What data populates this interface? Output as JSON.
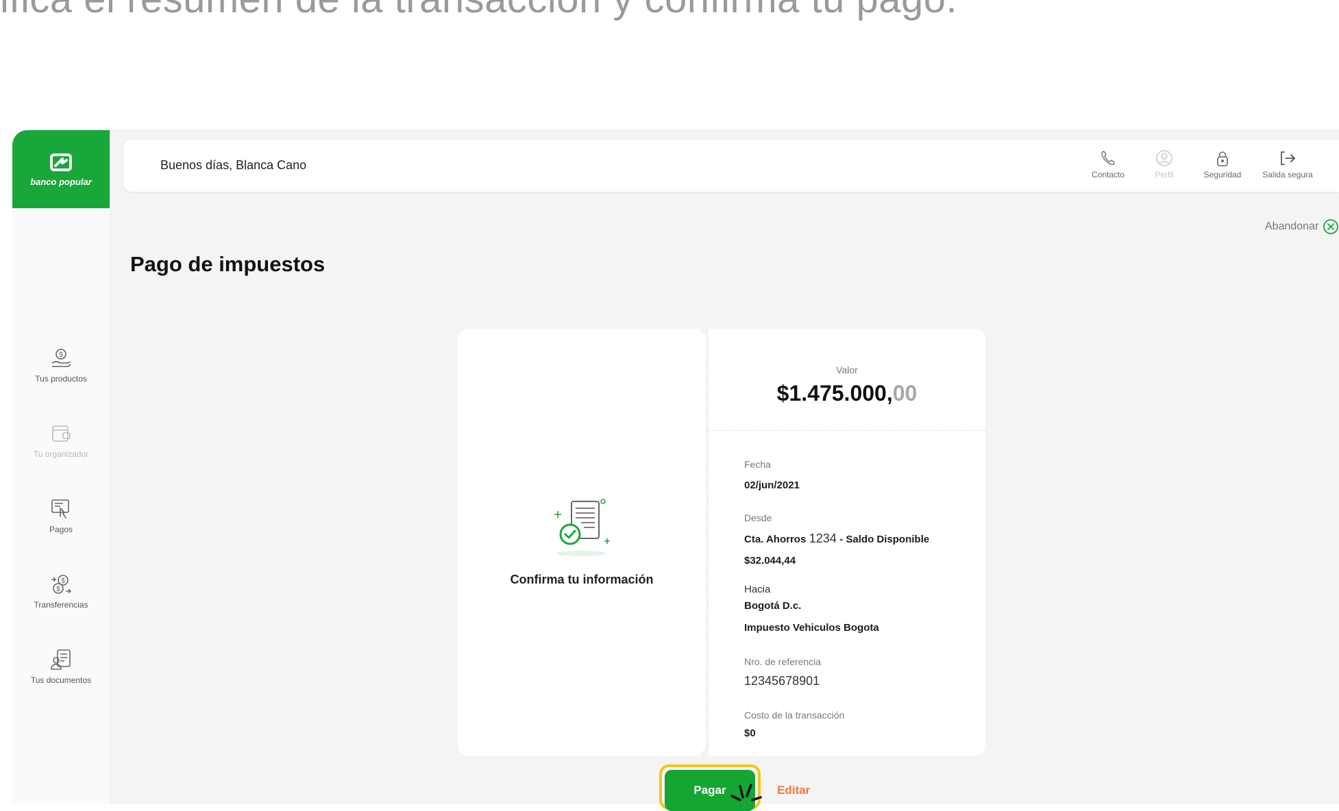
{
  "caption": "ifica el resumen de la transacción y confirma tu pago.",
  "brand": {
    "name": "banco popular",
    "color": "#19a73a"
  },
  "header": {
    "greeting": "Buenos días, Blanca Cano",
    "actions": [
      {
        "label": "Contacto",
        "icon": "phone-icon"
      },
      {
        "label": "Perfil",
        "icon": "profile-icon",
        "disabled": true
      },
      {
        "label": "Seguridad",
        "icon": "lock-icon"
      },
      {
        "label": "Salida segura",
        "icon": "logout-icon"
      }
    ]
  },
  "sidebar": {
    "items": [
      {
        "label": "Tus productos",
        "icon": "money-hand-icon"
      },
      {
        "label": "Tu organizador",
        "icon": "wallet-icon",
        "disabled": true
      },
      {
        "label": "Pagos",
        "icon": "payment-screen-icon"
      },
      {
        "label": "Transferencias",
        "icon": "transfer-coins-icon"
      },
      {
        "label": "Tus documentos",
        "icon": "documents-icon"
      }
    ]
  },
  "page": {
    "abandon_label": "Abandonar",
    "title": "Pago de impuestos"
  },
  "summary": {
    "confirm_text": "Confirma tu información",
    "value_label": "Valor",
    "value_main": "$1.475.000,",
    "value_cents": "00",
    "fecha_label": "Fecha",
    "fecha_value": "02/jun/2021",
    "desde_label": "Desde",
    "desde_account_type": "Cta. Ahorros",
    "desde_account_number": "1234",
    "desde_suffix": "- Saldo Disponible",
    "desde_balance": "$32.044,44",
    "hacia_label": "Hacia",
    "hacia_city": "Bogotá D.c.",
    "hacia_tax": "Impuesto Vehiculos Bogota",
    "ref_label": "Nro. de referencia",
    "ref_value": "12345678901",
    "cost_label": "Costo de la transacción",
    "cost_value": "$0"
  },
  "buttons": {
    "pay": "Pagar",
    "edit": "Editar"
  },
  "colors": {
    "primary": "#15a533",
    "highlight": "#f2c71b",
    "edit": "#f07a3a"
  }
}
